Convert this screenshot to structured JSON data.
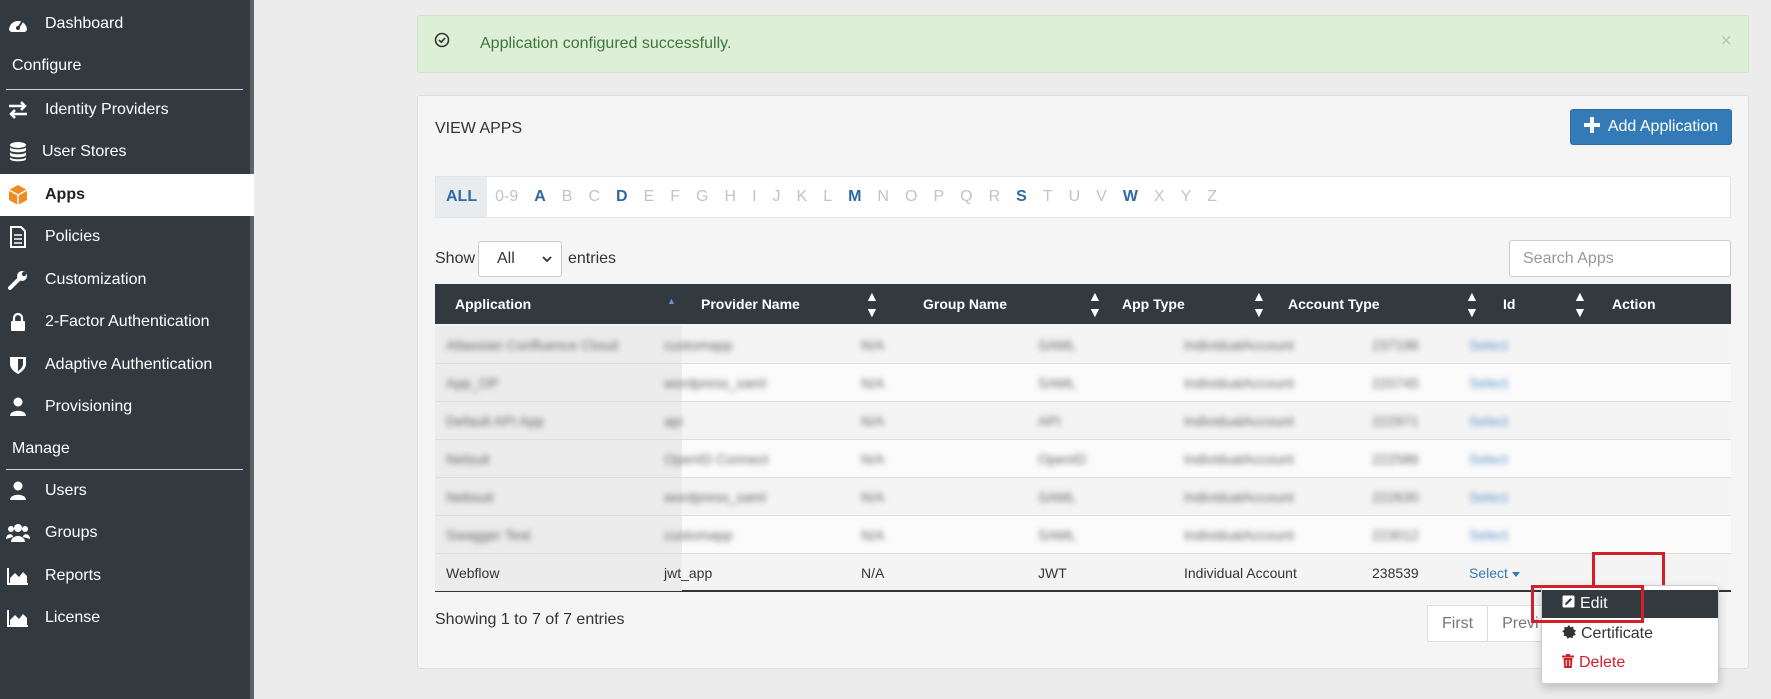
{
  "sidebar": {
    "items": [
      {
        "label": "Dashboard",
        "icon": "dashboard-icon"
      },
      {
        "label": "Identity Providers",
        "icon": "exchange-icon"
      },
      {
        "label": "User Stores",
        "icon": "database-icon"
      },
      {
        "label": "Apps",
        "icon": "cube-icon"
      },
      {
        "label": "Policies",
        "icon": "document-icon"
      },
      {
        "label": "Customization",
        "icon": "wrench-icon"
      },
      {
        "label": "2-Factor Authentication",
        "icon": "lock-icon"
      },
      {
        "label": "Adaptive Authentication",
        "icon": "shield-icon"
      },
      {
        "label": "Provisioning",
        "icon": "user-icon"
      },
      {
        "label": "Users",
        "icon": "user-icon"
      },
      {
        "label": "Groups",
        "icon": "users-icon"
      },
      {
        "label": "Reports",
        "icon": "area-chart-icon"
      },
      {
        "label": "License",
        "icon": "area-chart-icon"
      }
    ],
    "sections": {
      "configure": "Configure",
      "manage": "Manage"
    },
    "active_item": "Apps",
    "active_icon_color": "#f08a24"
  },
  "alert": {
    "message": "Application configured successfully.",
    "close": "×"
  },
  "panel": {
    "title": "VIEW APPS",
    "add_button": "Add Application",
    "alphabet": [
      "ALL",
      "0-9",
      "A",
      "B",
      "C",
      "D",
      "E",
      "F",
      "G",
      "H",
      "I",
      "J",
      "K",
      "L",
      "M",
      "N",
      "O",
      "P",
      "Q",
      "R",
      "S",
      "T",
      "U",
      "V",
      "W",
      "X",
      "Y",
      "Z"
    ],
    "alphabet_with_apps": [
      "A",
      "D",
      "M",
      "S",
      "W"
    ],
    "show_label": "Show",
    "show_value": "All",
    "entries_label": "entries",
    "search_placeholder": "Search Apps"
  },
  "table": {
    "columns": [
      "Application",
      "Provider Name",
      "Group Name",
      "App Type",
      "Account Type",
      "Id",
      "Action"
    ],
    "blurred_rows": [
      [
        "Atlassian Confluence Cloud",
        "customapp",
        "N/A",
        "SAML",
        "IndividualAccount",
        "237196",
        "Select"
      ],
      [
        "App_OP",
        "wordpress_saml",
        "N/A",
        "SAML",
        "IndividualAccount",
        "220745",
        "Select"
      ],
      [
        "Default API App",
        "api",
        "N/A",
        "API",
        "IndividualAccount",
        "222971",
        "Select"
      ],
      [
        "Netsuit",
        "OpenID Connect",
        "N/A",
        "OpenID",
        "IndividualAccount",
        "222586",
        "Select"
      ],
      [
        "Nebsuit",
        "wordpress_saml",
        "N/A",
        "SAML",
        "IndividualAccount",
        "222630",
        "Select"
      ],
      [
        "Swagger Test",
        "customapp",
        "N/A",
        "SAML",
        "IndividualAccount",
        "223012",
        "Select"
      ]
    ],
    "visible_row": {
      "application": "Webflow",
      "provider": "jwt_app",
      "group": "N/A",
      "app_type": "JWT",
      "account_type": "Individual Account",
      "id": "238539",
      "action": "Select"
    }
  },
  "footer": {
    "showing": "Showing 1 to 7 of 7 entries",
    "pager": [
      "First",
      "Previ"
    ]
  },
  "dropdown": {
    "items": [
      {
        "label": "Edit",
        "icon": "edit-icon"
      },
      {
        "label": "Certificate",
        "icon": "certificate-icon"
      },
      {
        "label": "Delete",
        "icon": "trash-icon"
      }
    ]
  },
  "colors": {
    "sidebar_bg": "#323a40",
    "primary": "#337ab7",
    "highlight": "#d21f2a",
    "success_bg": "#deefd8"
  }
}
